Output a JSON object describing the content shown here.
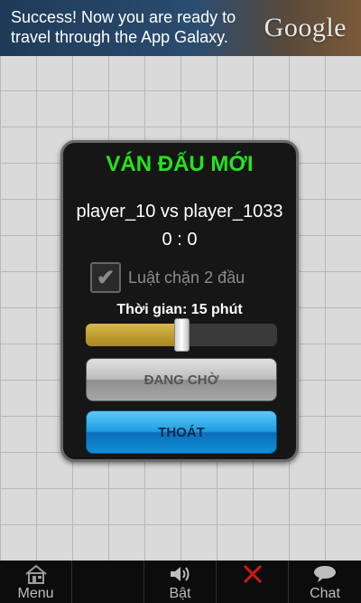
{
  "ad": {
    "text": "Success! Now you are ready to travel through the App Galaxy.",
    "logo": "Google"
  },
  "dialog": {
    "title": "VÁN ĐẤU MỚI",
    "players": "player_10 vs player_1033",
    "score": "0 : 0",
    "rule_checked": true,
    "rule_label": "Luật chặn 2 đầu",
    "time_label": "Thời gian: 15 phút",
    "time_slider_fraction": 0.5,
    "wait_button": "ĐANG CHỜ",
    "exit_button": "THOÁT"
  },
  "toolbar": {
    "items": [
      {
        "label": "Menu",
        "icon": "home-icon"
      },
      {
        "label": "",
        "icon": ""
      },
      {
        "label": "Bật",
        "icon": "speaker-icon"
      },
      {
        "label": "",
        "icon": "close-x-icon"
      },
      {
        "label": "Chat",
        "icon": "chat-bubble-icon"
      }
    ]
  },
  "colors": {
    "title_green": "#27e21f",
    "exit_blue": "#1e9de2",
    "slider_gold": "#c8a838",
    "x_red": "#d01818"
  }
}
